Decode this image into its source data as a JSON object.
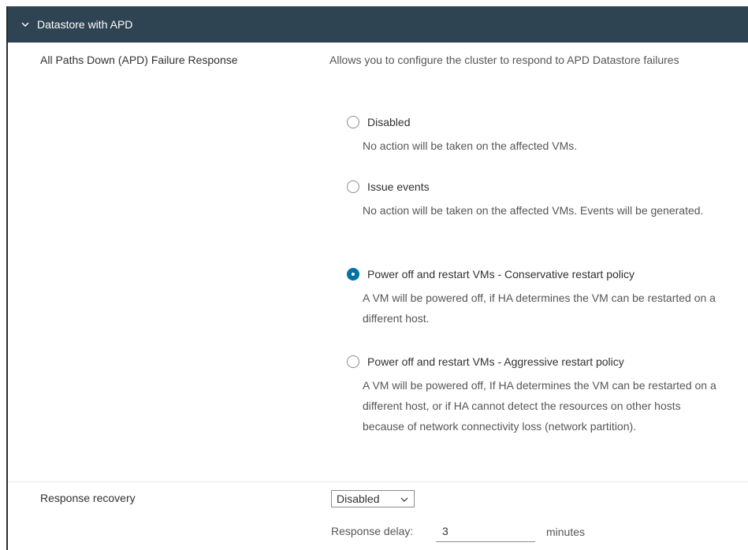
{
  "section": {
    "title": "Datastore with APD",
    "expanded": true,
    "header_color": "#2e4453"
  },
  "apd": {
    "label": "All Paths Down (APD) Failure Response",
    "description": "Allows you to configure the cluster to respond to APD Datastore failures",
    "options": [
      {
        "label": "Disabled",
        "description": "No action will be taken on the affected VMs.",
        "selected": false
      },
      {
        "label": "Issue events",
        "description": "No action will be taken on the affected VMs. Events will be generated.",
        "selected": false
      },
      {
        "label": "Power off and restart VMs - Conservative restart policy",
        "description": "A VM will be powered off, if HA determines the VM can be restarted on a different host.",
        "selected": true
      },
      {
        "label": "Power off and restart VMs - Aggressive restart policy",
        "description": "A VM will be powered off, If HA determines the VM can be restarted on a different host, or if HA cannot detect the resources on other hosts because of network connectivity loss (network partition).",
        "selected": false
      }
    ],
    "selected_color": "#0072a3"
  },
  "recovery": {
    "label": "Response recovery",
    "select_value": "Disabled",
    "delay_label": "Response delay:",
    "delay_value": "3",
    "delay_unit": "minutes"
  }
}
